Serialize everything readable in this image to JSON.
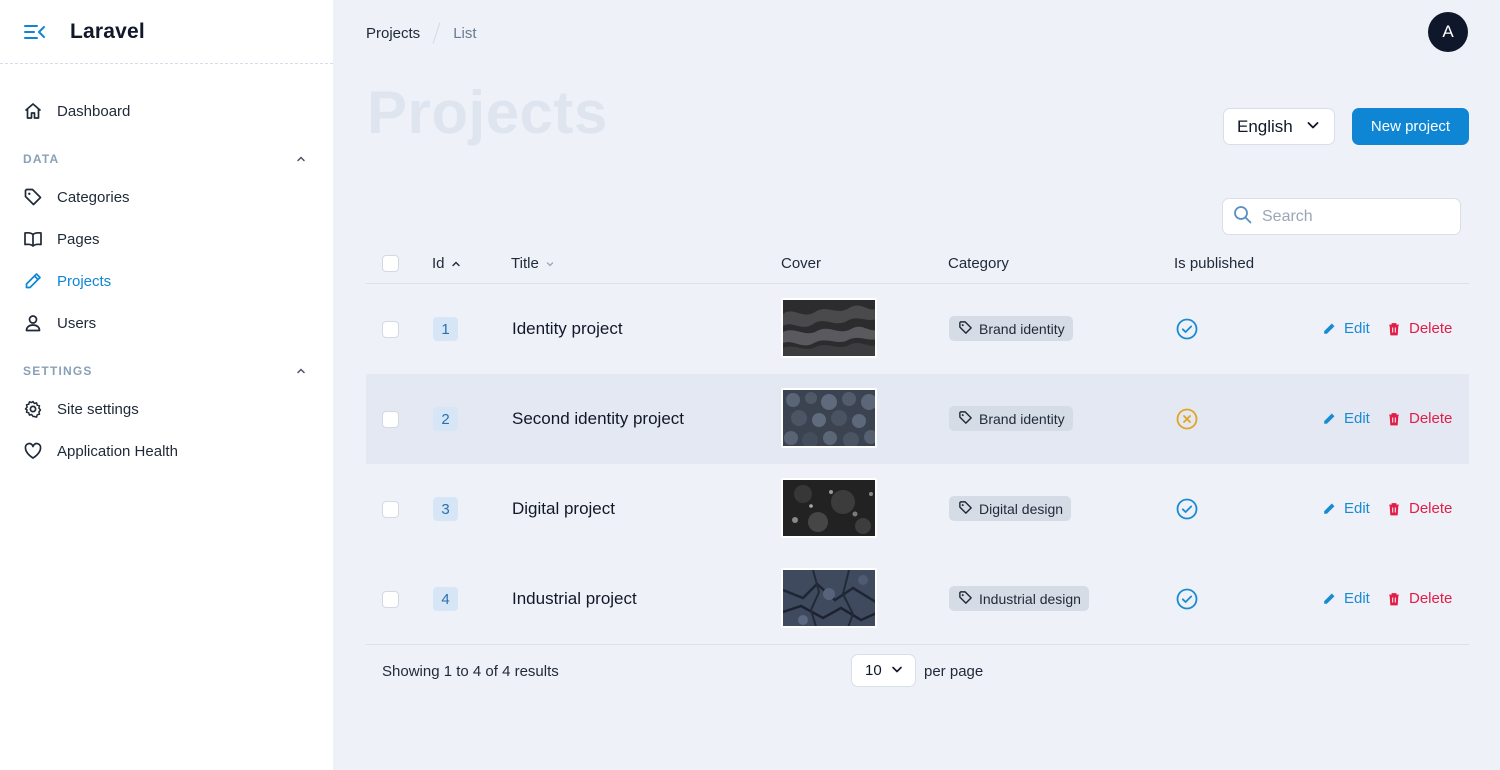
{
  "brand": {
    "name": "Laravel"
  },
  "sidebar": {
    "items": [
      {
        "label": "Dashboard",
        "icon": "home-icon"
      }
    ],
    "groups": [
      {
        "label": "DATA",
        "items": [
          {
            "label": "Categories",
            "icon": "tag-icon"
          },
          {
            "label": "Pages",
            "icon": "book-open-icon"
          },
          {
            "label": "Projects",
            "icon": "pencil-icon",
            "active": true
          },
          {
            "label": "Users",
            "icon": "user-icon"
          }
        ]
      },
      {
        "label": "SETTINGS",
        "items": [
          {
            "label": "Site settings",
            "icon": "gear-icon"
          },
          {
            "label": "Application Health",
            "icon": "heart-icon"
          }
        ]
      }
    ]
  },
  "breadcrumb": [
    "Projects",
    "List"
  ],
  "user": {
    "avatar_initial": "A"
  },
  "page": {
    "title": "Projects",
    "language": "English",
    "new_button": "New project",
    "search_placeholder": "Search"
  },
  "table": {
    "columns": [
      "Id",
      "Title",
      "Cover",
      "Category",
      "Is published"
    ],
    "rows": [
      {
        "id": "1",
        "title": "Identity project",
        "category": "Brand identity",
        "published": true,
        "edit": "Edit",
        "delete": "Delete"
      },
      {
        "id": "2",
        "title": "Second identity project",
        "category": "Brand identity",
        "published": false,
        "edit": "Edit",
        "delete": "Delete"
      },
      {
        "id": "3",
        "title": "Digital project",
        "category": "Digital design",
        "published": true,
        "edit": "Edit",
        "delete": "Delete"
      },
      {
        "id": "4",
        "title": "Industrial project",
        "category": "Industrial design",
        "published": true,
        "edit": "Edit",
        "delete": "Delete"
      }
    ]
  },
  "pagination": {
    "summary": "Showing 1 to 4 of 4 results",
    "per_page_value": "10",
    "per_page_label": "per page"
  },
  "colors": {
    "primary": "#0e86d4",
    "danger": "#e11d48",
    "published": "#1a8ad1",
    "unpublished": "#e0a526"
  }
}
